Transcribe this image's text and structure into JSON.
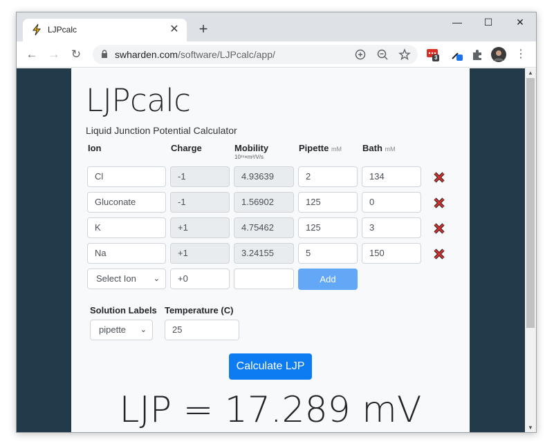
{
  "browser": {
    "tab_title": "LJPcalc",
    "tab_close": "✕",
    "new_tab": "+",
    "url_host": "swharden.com",
    "url_path": "/software/LJPcalc/app/",
    "ext_badge": "3",
    "controls": {
      "minimize": "—",
      "maximize": "☐",
      "close": "✕"
    },
    "nav": {
      "back": "←",
      "forward": "→",
      "reload": "↻"
    }
  },
  "app": {
    "title": "LJPcalc",
    "subtitle": "Liquid Junction Potential Calculator",
    "headers": {
      "ion": "Ion",
      "charge": "Charge",
      "mobility": "Mobility",
      "mobility_unit": "10¹¹×m²/V/s",
      "pipette": "Pipette",
      "pipette_unit": "mM",
      "bath": "Bath",
      "bath_unit": "mM"
    },
    "rows": [
      {
        "ion": "Cl",
        "charge": "-1",
        "mobility": "4.93639",
        "pipette": "2",
        "bath": "134"
      },
      {
        "ion": "Gluconate",
        "charge": "-1",
        "mobility": "1.56902",
        "pipette": "125",
        "bath": "0"
      },
      {
        "ion": "K",
        "charge": "+1",
        "mobility": "4.75462",
        "pipette": "125",
        "bath": "3"
      },
      {
        "ion": "Na",
        "charge": "+1",
        "mobility": "3.24155",
        "pipette": "5",
        "bath": "150"
      }
    ],
    "new_row": {
      "select_ion": "Select Ion",
      "charge": "+0",
      "mobility": "",
      "add_label": "Add"
    },
    "solution_labels_label": "Solution Labels",
    "solution_labels_value": "pipette",
    "temperature_label": "Temperature (C)",
    "temperature_value": "25",
    "calculate_label": "Calculate LJP",
    "result": "LJP = 17.289 mV"
  },
  "colors": {
    "page_bg": "#223a4a",
    "content_bg": "#f8f9fa",
    "primary": "#0d7cf2",
    "add_button": "#62a8f7",
    "delete_red": "#d32f2f"
  }
}
